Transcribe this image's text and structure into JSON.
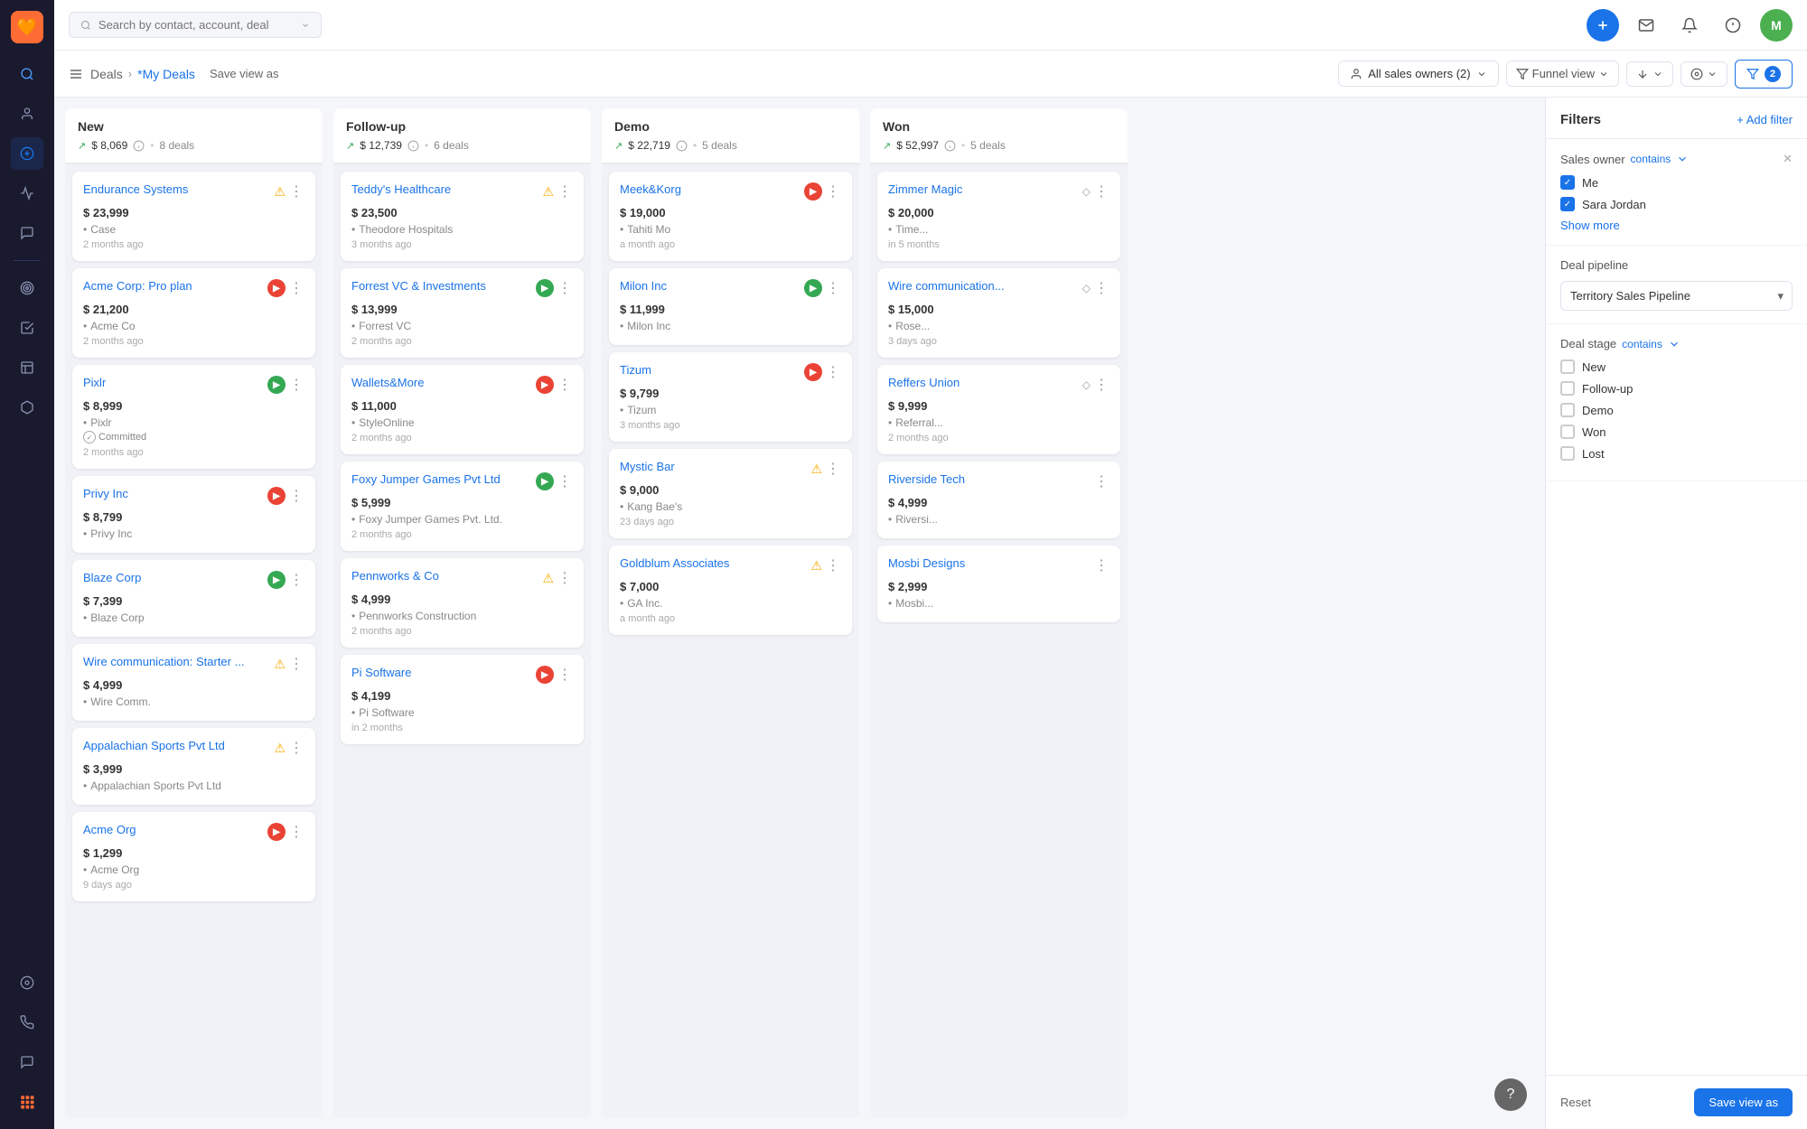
{
  "app": {
    "logo": "🧡",
    "search_placeholder": "Search by contact, account, deal"
  },
  "sidebar": {
    "icons": [
      {
        "name": "search-icon",
        "glyph": "🔍",
        "active": false
      },
      {
        "name": "contacts-icon",
        "glyph": "👤",
        "active": false
      },
      {
        "name": "deals-icon",
        "glyph": "💰",
        "active": true
      },
      {
        "name": "analytics-icon",
        "glyph": "📈",
        "active": false
      },
      {
        "name": "messages-icon",
        "glyph": "💬",
        "active": false
      },
      {
        "name": "goals-icon",
        "glyph": "🎯",
        "active": false
      },
      {
        "name": "tasks-icon",
        "glyph": "✅",
        "active": false
      },
      {
        "name": "reports-icon",
        "glyph": "📊",
        "active": false
      },
      {
        "name": "products-icon",
        "glyph": "📦",
        "active": false
      },
      {
        "name": "settings-icon",
        "glyph": "⚙️",
        "active": false
      }
    ],
    "bottom_icons": [
      {
        "name": "phone-icon",
        "glyph": "📞"
      },
      {
        "name": "chat-icon",
        "glyph": "💬"
      },
      {
        "name": "apps-icon",
        "glyph": "⊞"
      }
    ]
  },
  "header": {
    "breadcrumb": [
      "Deals",
      "*My Deals"
    ],
    "save_view_label": "Save view as",
    "owners_label": "All sales owners (2)",
    "funnel_view_label": "Funnel view",
    "filter_count": "2"
  },
  "columns": [
    {
      "id": "new",
      "title": "New",
      "amount": "$ 8,069",
      "count": "8 deals",
      "cards": [
        {
          "title": "Endurance Systems",
          "amount": "$ 23,999",
          "detail": "Case",
          "time": "2 months ago",
          "status": "warning",
          "menu": true
        },
        {
          "title": "Acme Corp: Pro plan",
          "amount": "$ 21,200",
          "detail": "Acme Co",
          "time": "2 months ago",
          "status": "red",
          "menu": true
        },
        {
          "title": "Pixlr",
          "amount": "$ 8,999",
          "detail": "Pixlr",
          "time": "2 months ago",
          "committed": "Committed",
          "status": "green",
          "menu": true
        },
        {
          "title": "Privy Inc",
          "amount": "$ 8,799",
          "detail": "Privy Inc",
          "time": "",
          "status": "red",
          "menu": true
        },
        {
          "title": "Blaze Corp",
          "amount": "$ 7,399",
          "detail": "Blaze Corp",
          "time": "",
          "status": "green",
          "menu": true
        },
        {
          "title": "Wire communication: Starter ...",
          "amount": "$ 4,999",
          "detail": "Wire Comm.",
          "time": "",
          "status": "warning",
          "menu": true
        },
        {
          "title": "Appalachian Sports Pvt Ltd",
          "amount": "$ 3,999",
          "detail": "Appalachian Sports Pvt Ltd",
          "time": "",
          "status": "warning",
          "menu": true
        },
        {
          "title": "Acme Org",
          "amount": "$ 1,299",
          "detail": "Acme Org",
          "time": "9 days ago",
          "status": "red",
          "menu": true
        }
      ]
    },
    {
      "id": "follow-up",
      "title": "Follow-up",
      "amount": "$ 12,739",
      "count": "6 deals",
      "cards": [
        {
          "title": "Teddy's Healthcare",
          "amount": "$ 23,500",
          "detail": "Theodore Hospitals",
          "time": "3 months ago",
          "status": "warning",
          "menu": true
        },
        {
          "title": "Forrest VC & Investments",
          "amount": "$ 13,999",
          "detail": "Forrest VC",
          "time": "2 months ago",
          "status": "green",
          "menu": true
        },
        {
          "title": "Wallets&More",
          "amount": "$ 11,000",
          "detail": "StyleOnline",
          "time": "2 months ago",
          "status": "red",
          "menu": true
        },
        {
          "title": "Foxy Jumper Games Pvt Ltd",
          "amount": "$ 5,999",
          "detail": "Foxy Jumper Games Pvt. Ltd.",
          "time": "2 months ago",
          "status": "green",
          "menu": true
        },
        {
          "title": "Pennworks & Co",
          "amount": "$ 4,999",
          "detail": "Pennworks Construction",
          "time": "2 months ago",
          "status": "warning",
          "menu": true
        },
        {
          "title": "Pi Software",
          "amount": "$ 4,199",
          "detail": "Pi Software",
          "time": "in 2 months",
          "status": "red",
          "menu": true
        }
      ]
    },
    {
      "id": "demo",
      "title": "Demo",
      "amount": "$ 22,719",
      "count": "5 deals",
      "cards": [
        {
          "title": "Meek&Korg",
          "amount": "$ 19,000",
          "detail": "Tahiti Mo",
          "time": "a month ago",
          "status": "red",
          "menu": true
        },
        {
          "title": "Milon Inc",
          "amount": "$ 11,999",
          "detail": "Milon Inc",
          "time": "",
          "status": "green",
          "menu": true
        },
        {
          "title": "Tizum",
          "amount": "$ 9,799",
          "detail": "Tizum",
          "time": "3 months ago",
          "status": "red",
          "menu": true
        },
        {
          "title": "Mystic Bar",
          "amount": "$ 9,000",
          "detail": "Kang Bae's",
          "time": "23 days ago",
          "status": "warning",
          "menu": true
        },
        {
          "title": "Goldblum Associates",
          "amount": "$ 7,000",
          "detail": "GA Inc.",
          "time": "a month ago",
          "status": "warning",
          "menu": true
        }
      ]
    },
    {
      "id": "won",
      "title": "Won",
      "amount": "$ 52,997",
      "count": "5 deals",
      "cards": [
        {
          "title": "Zimmer Magic",
          "amount": "$ 20,000",
          "detail": "Time...",
          "time": "in 5 months",
          "status": "diamond",
          "menu": true
        },
        {
          "title": "Wire communication...",
          "amount": "$ 15,000",
          "detail": "Rose...",
          "time": "3 days ago",
          "status": "diamond",
          "menu": true
        },
        {
          "title": "Reffers Union",
          "amount": "$ 9,999",
          "detail": "Referral...",
          "time": "2 months ago",
          "status": "diamond",
          "menu": true
        },
        {
          "title": "Riverside Tech",
          "amount": "$ 4,999",
          "detail": "Riversi...",
          "time": "",
          "status": "none",
          "menu": true
        },
        {
          "title": "Mosbi Designs",
          "amount": "$ 2,999",
          "detail": "Mosbi...",
          "time": "",
          "status": "none",
          "menu": true
        }
      ]
    }
  ],
  "filters": {
    "title": "Filters",
    "add_filter_label": "+ Add filter",
    "sales_owner": {
      "label": "Sales owner",
      "operator": "contains",
      "options": [
        {
          "label": "Me",
          "checked": true
        },
        {
          "label": "Sara Jordan",
          "checked": true
        }
      ],
      "show_more": "Show more"
    },
    "deal_pipeline": {
      "label": "Deal pipeline",
      "value": "Territory Sales Pipeline"
    },
    "deal_stage": {
      "label": "Deal stage",
      "operator": "contains",
      "options": [
        {
          "label": "New",
          "checked": false
        },
        {
          "label": "Follow-up",
          "checked": false
        },
        {
          "label": "Demo",
          "checked": false
        },
        {
          "label": "Won",
          "checked": false
        },
        {
          "label": "Lost",
          "checked": false
        }
      ]
    },
    "reset_label": "Reset",
    "save_view_label": "Save view as"
  },
  "help_btn": "?"
}
